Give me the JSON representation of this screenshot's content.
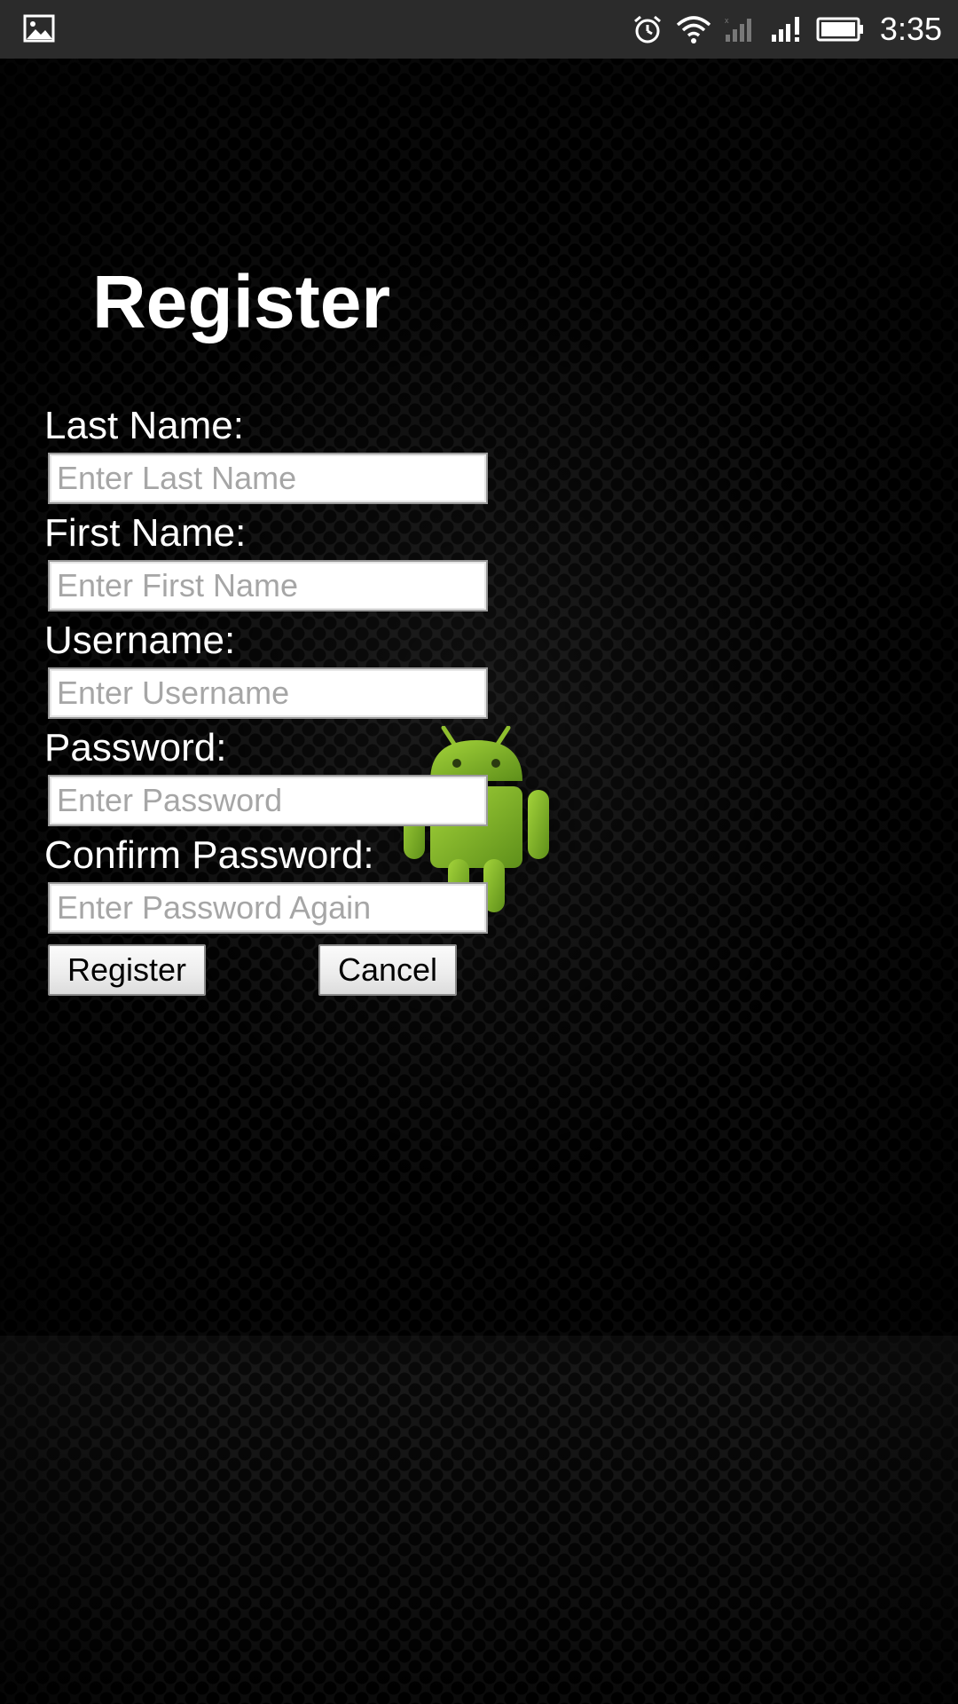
{
  "status_bar": {
    "time": "3:35",
    "icons": [
      "image-notification-icon",
      "alarm-icon",
      "wifi-icon",
      "signal-sim1-icon",
      "signal-sim2-icon",
      "battery-icon"
    ]
  },
  "form": {
    "title": "Register",
    "fields": [
      {
        "label": "Last Name:",
        "placeholder": "Enter Last Name",
        "value": ""
      },
      {
        "label": "First Name:",
        "placeholder": "Enter First Name",
        "value": ""
      },
      {
        "label": "Username:",
        "placeholder": "Enter Username",
        "value": ""
      },
      {
        "label": "Password:",
        "placeholder": "Enter Password",
        "value": ""
      },
      {
        "label": "Confirm Password:",
        "placeholder": "Enter Password Again",
        "value": ""
      }
    ],
    "register_label": "Register",
    "cancel_label": "Cancel"
  },
  "colors": {
    "status_bar": "#2b2b2b",
    "background": "#111111",
    "android_green": "#8bc34a"
  }
}
